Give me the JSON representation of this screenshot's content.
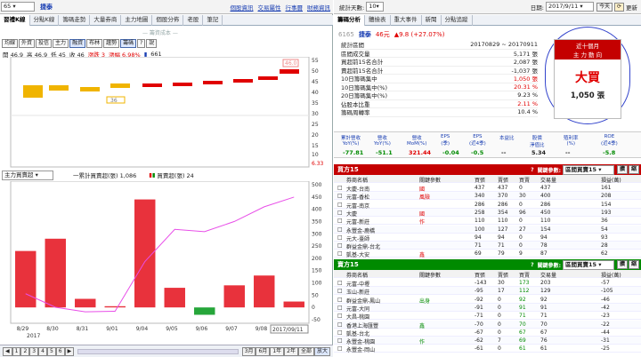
{
  "left_top": {
    "code_combo": "65",
    "name": "捷泰",
    "links": [
      "個股資訊",
      "交易屬性",
      "行事曆",
      "財務資訊"
    ]
  },
  "tabs_left": [
    "習禮K線",
    "分點K線",
    "籌碼走勢",
    "大量券商",
    "主力地圖",
    "個股分佈",
    "老股",
    "筆記"
  ],
  "legend_top": "籌資成本",
  "tools": [
    {
      "label": "均線",
      "on": false
    },
    {
      "label": "外資",
      "on": false
    },
    {
      "label": "投信",
      "on": false
    },
    {
      "label": "主力",
      "on": false
    },
    {
      "label": "融資",
      "on": true
    },
    {
      "label": "布林",
      "on": false
    },
    {
      "label": "趨勢",
      "on": false
    },
    {
      "label": "籌碼",
      "on": true
    },
    {
      "label": "?",
      "on": false
    },
    {
      "label": "說",
      "on": false
    }
  ],
  "ohlc": {
    "open": "開 46.9",
    "high": "高 46.9",
    "low": "低 45",
    "close": "收 46",
    "chg": "漲跌 3",
    "pct": "漲幅 6.98%",
    "vol": "661"
  },
  "kchart": {
    "y_ticks": [
      "55",
      "50",
      "45",
      "40",
      "35",
      "30",
      "25",
      "20",
      "15",
      "10",
      "6.33"
    ],
    "price_label": "46.0",
    "low_label": "36"
  },
  "lower_panel": {
    "combo": "主力買賣超",
    "legend1": "一累計買賣超(張) 1,086",
    "legend2": "買賣超(張) 24",
    "y_ticks": [
      "500",
      "450",
      "400",
      "350",
      "300",
      "250",
      "200",
      "150",
      "100",
      "50",
      "0",
      "-50"
    ],
    "x_labels": [
      "8/29",
      "8/30",
      "8/31",
      "9/01",
      "9/04",
      "9/05",
      "9/06",
      "9/07",
      "9/08"
    ],
    "year_label": "2017",
    "date_box": "2017/09/11"
  },
  "bottom_bar": {
    "pages": [
      "1",
      "2",
      "3",
      "4",
      "5",
      "6"
    ],
    "ranges": [
      "3月",
      "6月",
      "1年",
      "2年",
      "全部",
      "放大"
    ]
  },
  "right_top": {
    "days_label": "統計天數:",
    "days_value": "10",
    "date_label": "日期:",
    "date_value": "2017/9/11",
    "today_btn": "今天",
    "refresh_label": "更新"
  },
  "rtabs": [
    "籌碼分析",
    "體檢表",
    "重大事件",
    "新聞",
    "分點追蹤"
  ],
  "stock": {
    "code": "6165",
    "name": "捷泰",
    "price": "46元",
    "change": "▲9.8 (+27.07%)"
  },
  "stats": [
    {
      "label": "統計區間",
      "value": "20170829 ~ 20170911",
      "cls": ""
    },
    {
      "label": "區間成交量",
      "value": "5,171 張",
      "cls": ""
    },
    {
      "label": "買超前15名合計",
      "value": "2,087 張",
      "cls": ""
    },
    {
      "label": "賣超前15名合計",
      "value": "-1,037 張",
      "cls": ""
    },
    {
      "label": "10日籌碼集中",
      "value": "1,050 張",
      "cls": "red"
    },
    {
      "label": "10日籌碼集中(%)",
      "value": "20.31 %",
      "cls": "red"
    },
    {
      "label": "20日籌碼集中(%)",
      "value": "9.23 %",
      "cls": ""
    },
    {
      "label": "佔股本比重",
      "value": "2.11 %",
      "cls": "red"
    },
    {
      "label": "籌碼周轉率",
      "value": "10.4 %",
      "cls": ""
    }
  ],
  "summary_box": {
    "title1": "近十個月",
    "title2": "主 力 動 向",
    "big": "大買",
    "amount": "1,050 張"
  },
  "fund_headers": [
    "累計營收\nYoY(%)",
    "營收\nYoY(%)",
    "營收\nMoM(%)",
    "EPS\n(季)",
    "EPS\n(近4季)",
    "本益比",
    "股價\n淨值比",
    "殖利率\n(%)",
    "ROE\n(近4季)"
  ],
  "fund_values": [
    {
      "v": "-77.81",
      "cls": "green"
    },
    {
      "v": "-51.1",
      "cls": "green"
    },
    {
      "v": "321.44",
      "cls": "red"
    },
    {
      "v": "-0.04",
      "cls": "green"
    },
    {
      "v": "-0.5",
      "cls": "green"
    },
    {
      "v": "--",
      "cls": ""
    },
    {
      "v": "5.34",
      "cls": ""
    },
    {
      "v": "--",
      "cls": ""
    },
    {
      "v": "-5.8",
      "cls": "green"
    }
  ],
  "buy": {
    "title": "買方15",
    "ref_label": "關鍵參數:",
    "ref_value": "區間買賣15",
    "btn1": "擴",
    "btn2": "縮",
    "headers": [
      "券商名稱",
      "關鍵參數",
      "買張",
      "賣張",
      "買賣",
      "交易量",
      "損益(萬)"
    ],
    "rows": [
      [
        "大慶-台南",
        "國",
        "437",
        "437",
        "0",
        "437",
        "161"
      ],
      [
        "元富-香松",
        "風險",
        "340",
        "370",
        "30",
        "400",
        "208"
      ],
      [
        "元富-南京",
        "",
        "286",
        "286",
        "0",
        "286",
        "154"
      ],
      [
        "大慶",
        "國",
        "258",
        "354",
        "96",
        "450",
        "193"
      ],
      [
        "元富-新莊",
        "作",
        "110",
        "110",
        "0",
        "110",
        "36"
      ],
      [
        "永豐金-鹿橋",
        "",
        "100",
        "127",
        "27",
        "154",
        "54"
      ],
      [
        "元大-臺師",
        "",
        "94",
        "94",
        "0",
        "94",
        "93"
      ],
      [
        "群益金鼎-台北",
        "",
        "71",
        "71",
        "0",
        "78",
        "28"
      ],
      [
        "凱基-大安",
        "鑫",
        "69",
        "79",
        "9",
        "87",
        "62"
      ]
    ]
  },
  "sell": {
    "title": "賣方15",
    "ref_label": "關鍵參數:",
    "ref_value": "區間買賣15",
    "btn1": "擴",
    "btn2": "縮",
    "headers": [
      "券商名稱",
      "關鍵參數",
      "買張",
      "賣張",
      "買賣",
      "交易量",
      "損益(萬)"
    ],
    "rows": [
      [
        "元富-中壢",
        "",
        "-143",
        "30",
        "173",
        "203",
        "-57"
      ],
      [
        "玉山-新莊",
        "",
        "-95",
        "17",
        "112",
        "129",
        "-105"
      ],
      [
        "群益金鼎-鳳山",
        "出身",
        "-92",
        "0",
        "92",
        "92",
        "-46"
      ],
      [
        "元富-大同",
        "",
        "-91",
        "0",
        "91",
        "91",
        "-42"
      ],
      [
        "大昌-桃園",
        "",
        "-71",
        "0",
        "71",
        "71",
        "-23"
      ],
      [
        "香港上海匯豐",
        "鑫",
        "-70",
        "0",
        "70",
        "70",
        "-22"
      ],
      [
        "凱基-台北",
        "",
        "-67",
        "0",
        "67",
        "67",
        "-44"
      ],
      [
        "永豐金-桃園",
        "作",
        "-62",
        "7",
        "69",
        "76",
        "-31"
      ],
      [
        "永豐金-岡山",
        "",
        "-61",
        "0",
        "61",
        "61",
        "-25"
      ]
    ]
  },
  "chart_data": [
    {
      "type": "bar",
      "title": "",
      "categories": [
        "8/29",
        "8/30",
        "8/31",
        "9/01",
        "9/04",
        "9/05",
        "9/06",
        "9/07",
        "9/08",
        "9/11"
      ],
      "series": [
        {
          "name": "買賣超(張)",
          "values": [
            230,
            280,
            35,
            5,
            440,
            80,
            -30,
            90,
            130,
            24
          ]
        },
        {
          "name": "累計買賣超(張)",
          "values": [
            230,
            110,
            70,
            75,
            515,
            800,
            780,
            870,
            1000,
            1086
          ]
        }
      ],
      "ylim": [
        -50,
        500
      ]
    }
  ]
}
